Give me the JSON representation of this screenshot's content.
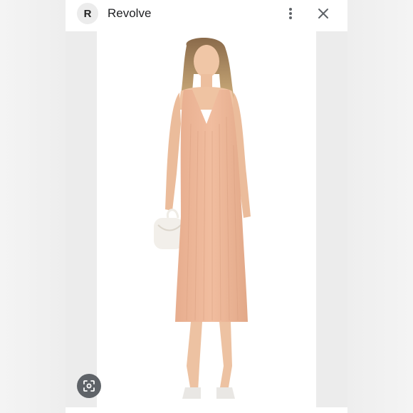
{
  "header": {
    "logo_letter": "R",
    "title": "Revolve",
    "more_icon": "more-vert-icon",
    "close_icon": "close-icon"
  },
  "product_image": {
    "subject": "model-in-peach-ribbed-knit-midi-dress"
  },
  "lens": {
    "icon": "lens-search-icon"
  },
  "colors": {
    "dress": "#eeb89a",
    "background": "#ffffff",
    "lens_button": "#5f6368"
  }
}
